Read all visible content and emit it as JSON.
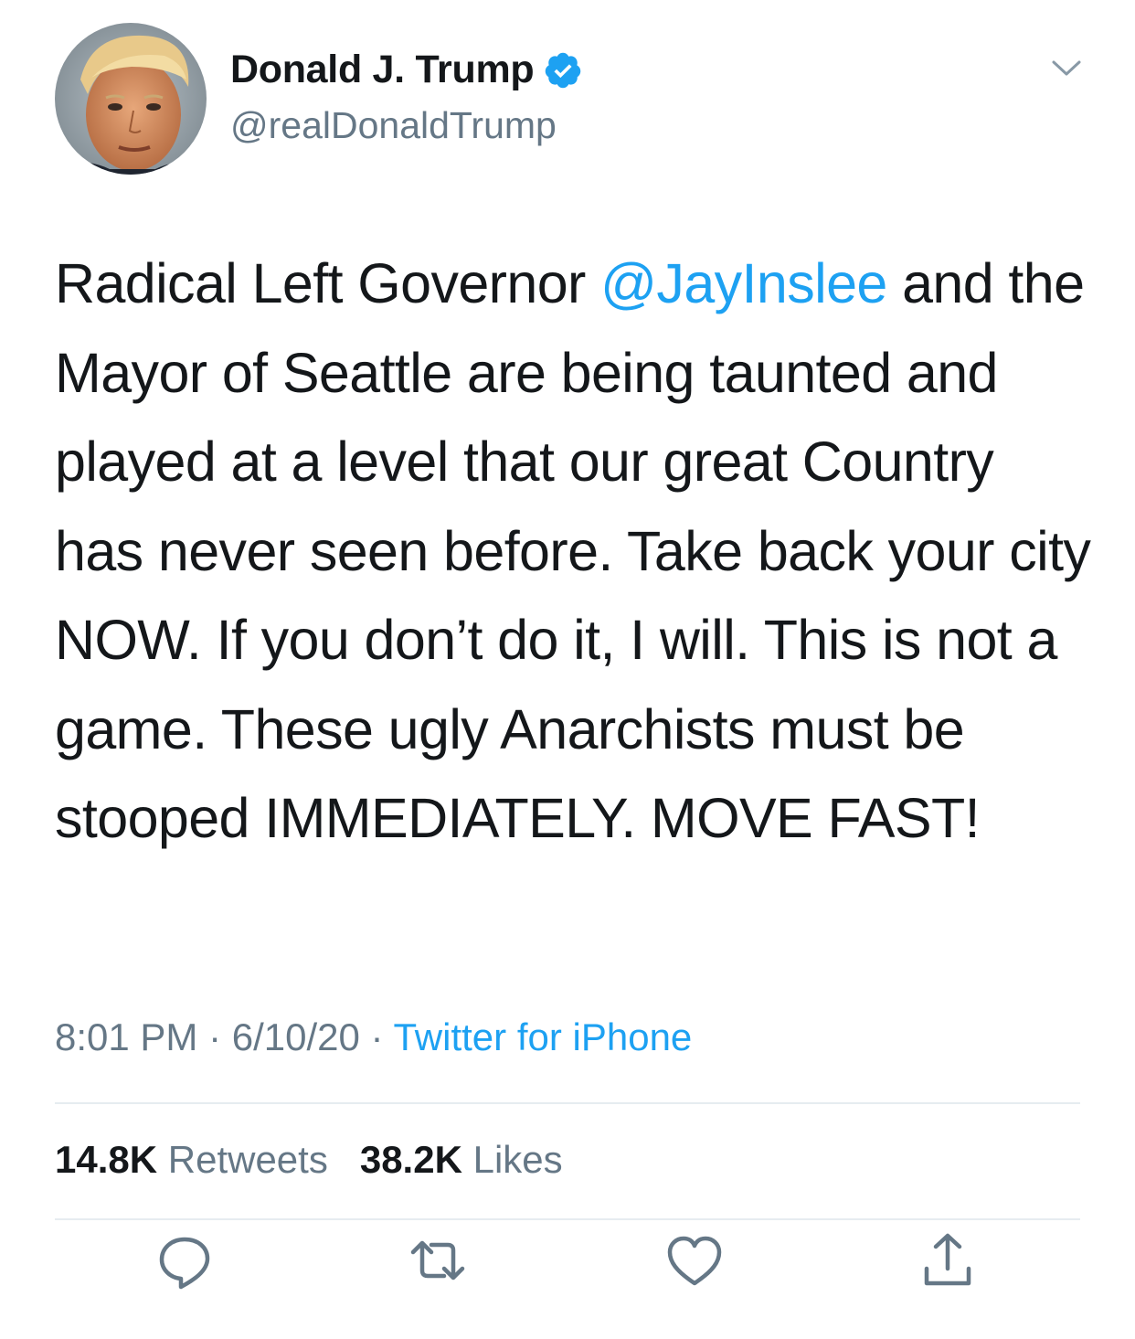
{
  "author": {
    "display_name": "Donald J. Trump",
    "handle": "@realDonaldTrump",
    "verified": true,
    "avatar_icon": "profile-photo"
  },
  "tweet": {
    "text_before_mention": "Radical Left Governor ",
    "mention": "@JayInslee",
    "text_after_mention": " and the Mayor of Seattle are being taunted and played at a level that our great Country has never seen before. Take back your city NOW. If you don’t do it, I will. This is not a game. These ugly Anarchists must be stooped IMMEDIATELY. MOVE FAST!"
  },
  "meta": {
    "time": "8:01 PM",
    "separator": " · ",
    "date": "6/10/20",
    "source": "Twitter for iPhone"
  },
  "stats": {
    "retweets_count": "14.8K",
    "retweets_label": "Retweets",
    "likes_count": "38.2K",
    "likes_label": "Likes"
  },
  "actions": {
    "reply_icon": "reply-icon",
    "retweet_icon": "retweet-icon",
    "like_icon": "heart-icon",
    "share_icon": "share-icon"
  },
  "colors": {
    "accent": "#1da1f2",
    "text_primary": "#14171a",
    "text_secondary": "#657786",
    "divider": "#e6ecf0",
    "icon": "#657786"
  }
}
